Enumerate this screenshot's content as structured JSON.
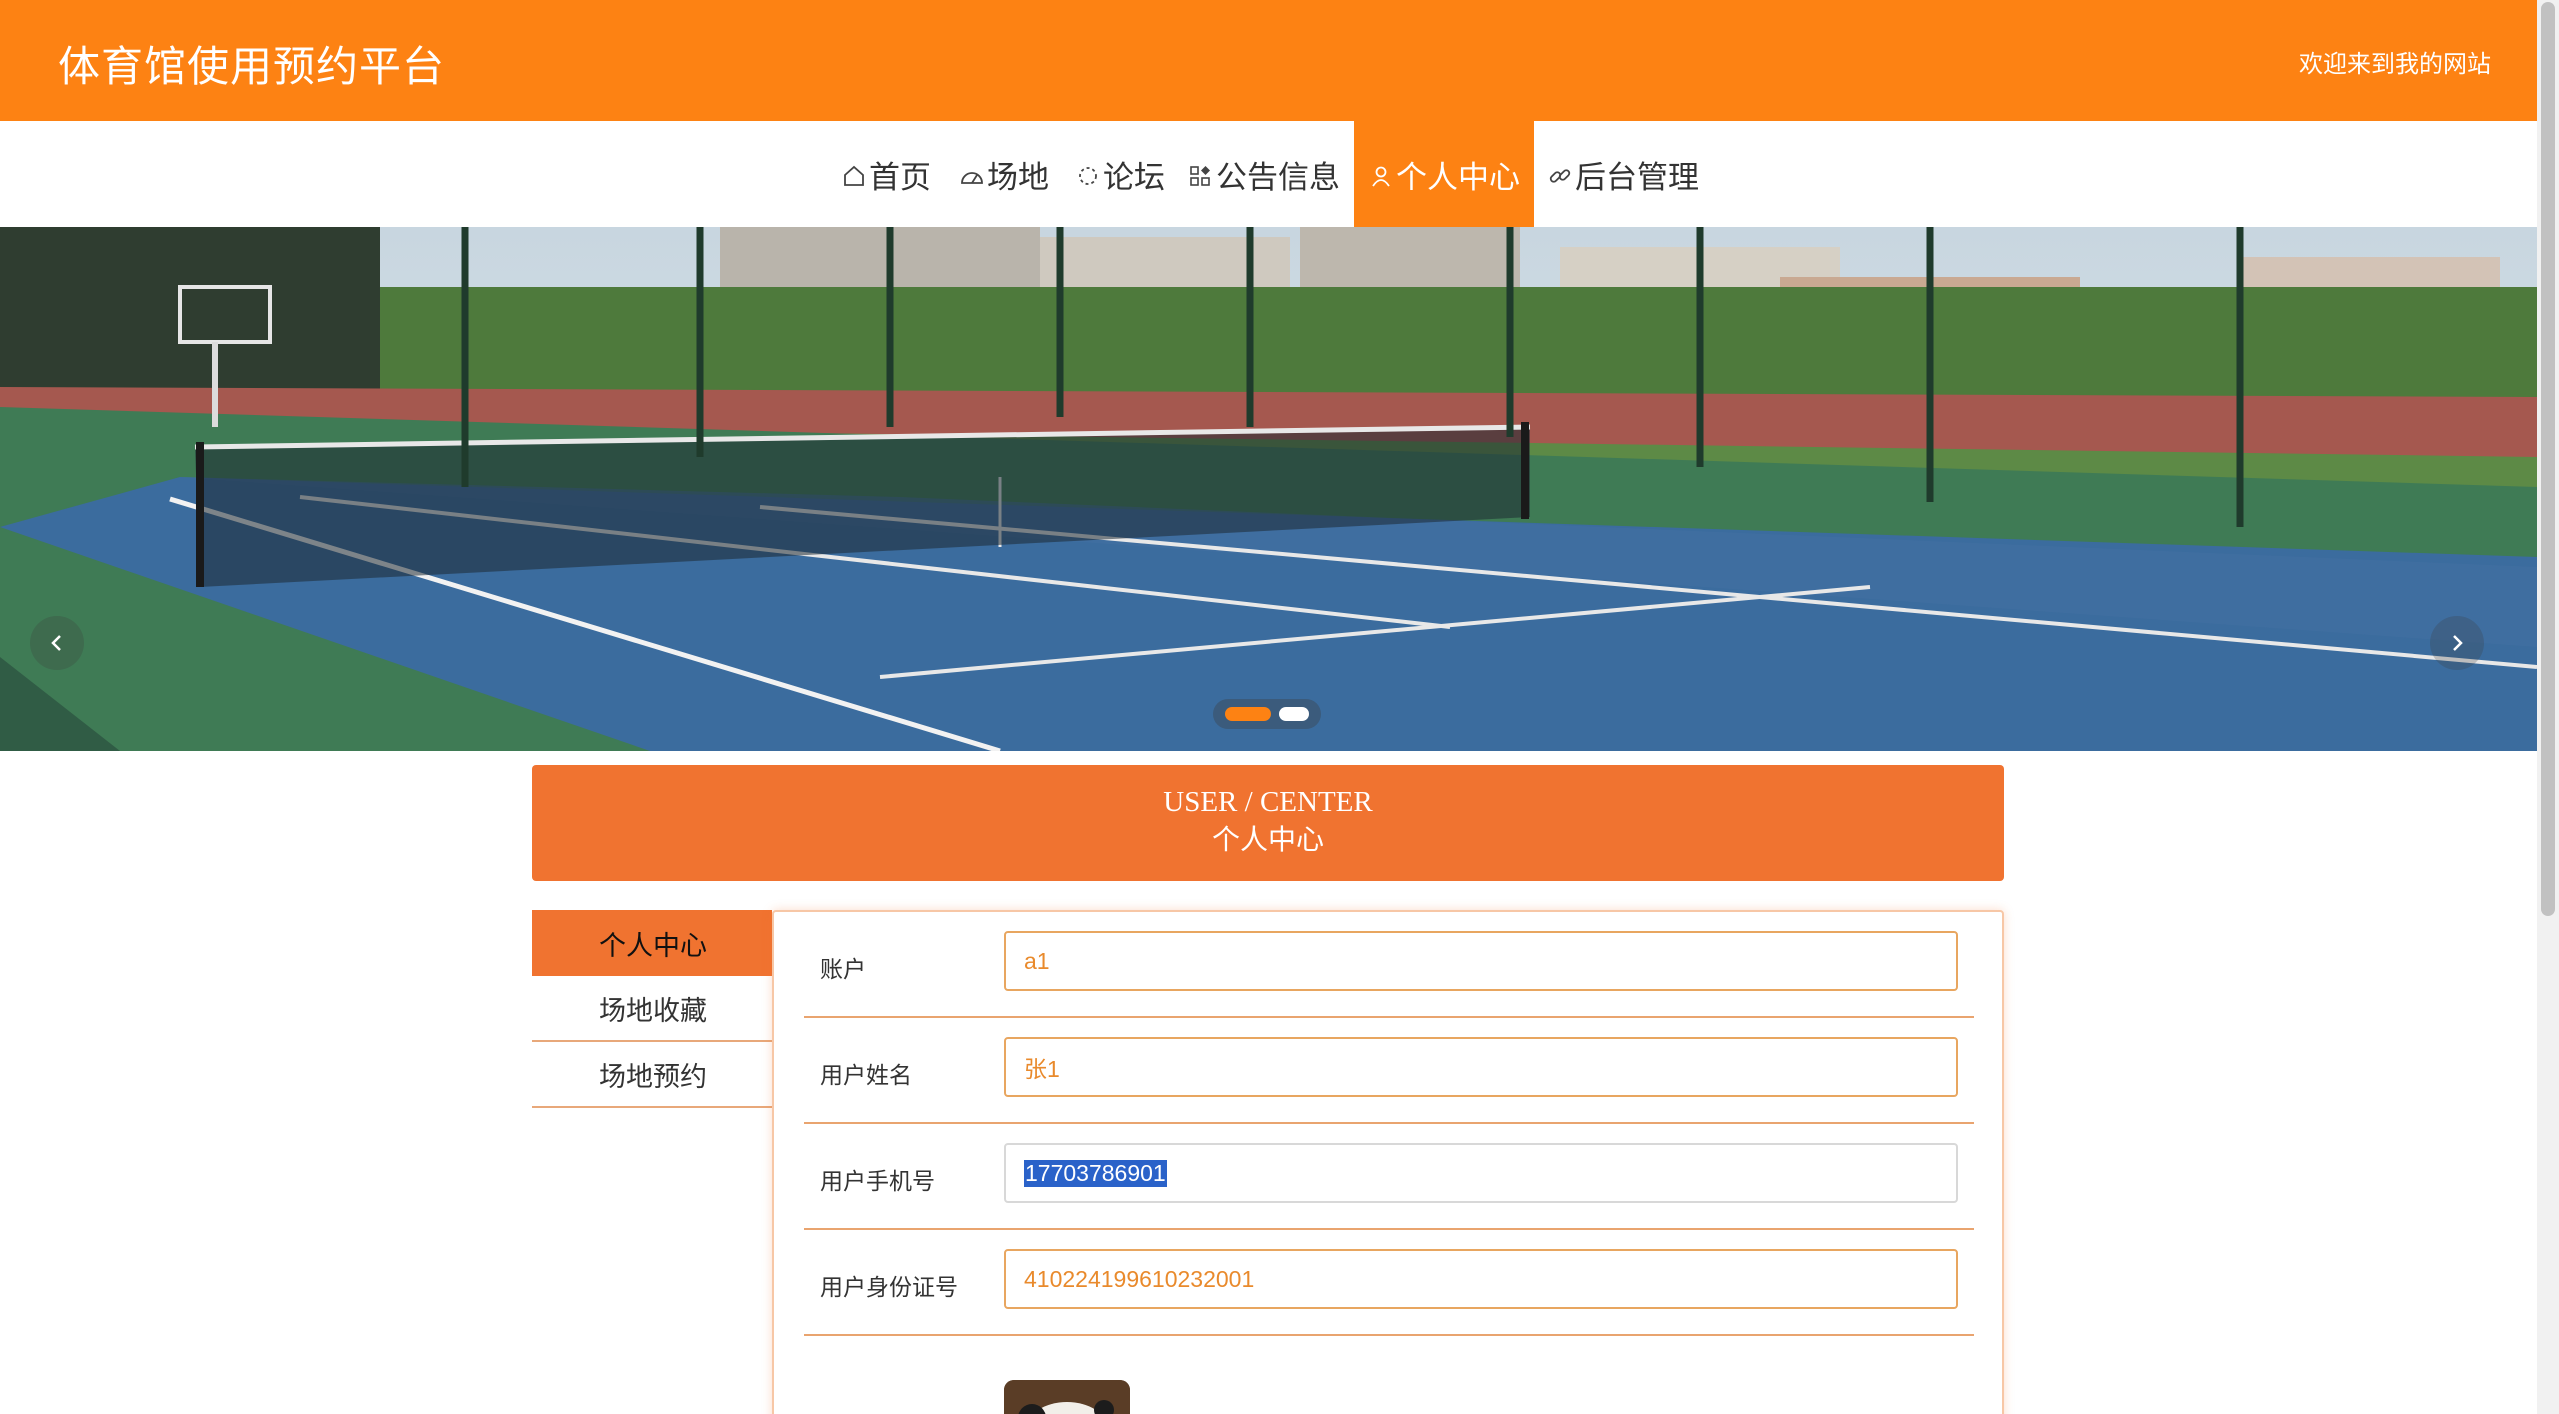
{
  "header": {
    "title": "体育馆使用预约平台",
    "welcome": "欢迎来到我的网站"
  },
  "nav": {
    "items": [
      {
        "label": "首页",
        "icon": "home-icon"
      },
      {
        "label": "场地",
        "icon": "dashboard-icon"
      },
      {
        "label": "论坛",
        "icon": "loading-icon"
      },
      {
        "label": "公告信息",
        "icon": "apps-icon"
      },
      {
        "label": "个人中心",
        "icon": "user-icon",
        "active": true
      },
      {
        "label": "后台管理",
        "icon": "link-icon"
      }
    ]
  },
  "banner": {
    "slide_count": 2,
    "active_slide": 1,
    "prev_icon": "chevron-left-icon",
    "next_icon": "chevron-right-icon"
  },
  "section": {
    "title_en": "USER / CENTER",
    "title_cn": "个人中心"
  },
  "side_menu": {
    "items": [
      {
        "label": "个人中心",
        "active": true
      },
      {
        "label": "场地收藏"
      },
      {
        "label": "场地预约"
      }
    ]
  },
  "form": {
    "fields": [
      {
        "label": "账户",
        "value": "a1"
      },
      {
        "label": "用户姓名",
        "value": "张1"
      },
      {
        "label": "用户手机号",
        "value": "17703786901",
        "selected": true
      },
      {
        "label": "用户身份证号",
        "value": "410224199610232001"
      }
    ]
  },
  "colors": {
    "accent": "#fd8213",
    "section": "#f07330",
    "input_text": "#e98a2c"
  }
}
